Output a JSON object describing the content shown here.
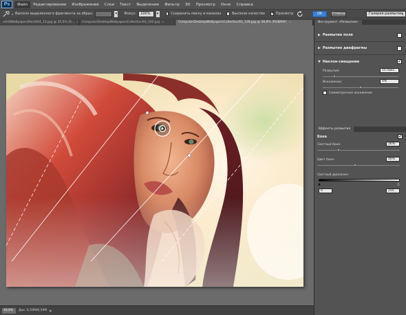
{
  "app": {
    "logo": "Ps"
  },
  "menu": [
    "Файл",
    "Редактирование",
    "Изображение",
    "Слои",
    "Текст",
    "Выделение",
    "Фильтр",
    "3D",
    "Просмотр",
    "Окно",
    "Справка"
  ],
  "options": {
    "selection_label": "Выполн выделенного фрагмента за образ:",
    "focus_label": "Фокус:",
    "focus_value": "100%",
    "save_mask_label": "Сохранить маску в каналах",
    "high_quality_label": "Высокое качество",
    "preview_label": "Просмотр",
    "ok_label": "OK",
    "cancel_label": "Отмена",
    "blur_select_value": "Галерея размытия"
  },
  "tabs": [
    {
      "label": "ckHDWallpapersPack944_15.jpg @ 35,5% (R...",
      "active": false
    },
    {
      "label": "ComputerDesktopWallpapersCollection93_102.jpg",
      "active": false
    },
    {
      "label": "ComputerDesktopWallpapersCollection93_128.jpg @ 48,8% (RGB/8#)",
      "active": true
    }
  ],
  "status": {
    "zoom": "48,8%",
    "doc": "Док: 6,59M/6,59M"
  },
  "panel": {
    "tab_label": "Инструмент «Размытие»",
    "field_blur": {
      "label": "Размытие поля",
      "checked": false
    },
    "iris_blur": {
      "label": "Размытие диафрагмы",
      "checked": false
    },
    "tilt_shift": {
      "label": "Наклон-смещение",
      "checked": true,
      "blur_label": "Размытие:",
      "blur_value": "15 пикс.",
      "blur_level": 0.15,
      "distortion_label": "Искажение:",
      "distortion_value": "0%",
      "distortion_level": 0.5,
      "symmetric_label": "Симметричное искажение"
    }
  },
  "effects": {
    "tab_label": "Эффекты размытия",
    "bokeh_label": "Боке",
    "bokeh_checked": true,
    "light_bokeh_label": "Светлый боке:",
    "light_bokeh_value": "26%",
    "light_bokeh_level": 0.26,
    "color_bokeh_label": "Цвет боке:",
    "color_bokeh_value": "46%",
    "color_bokeh_level": 0.46,
    "light_range_label": "Светлый диапазон:",
    "range_min": "0",
    "range_max": "255"
  }
}
